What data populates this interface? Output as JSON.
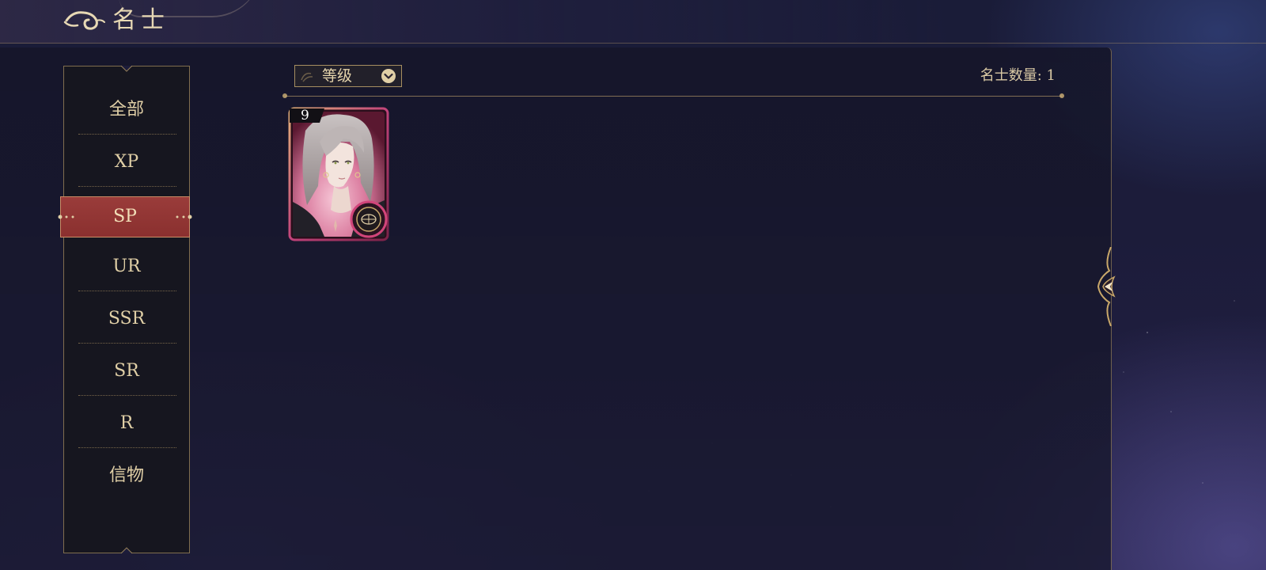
{
  "header": {
    "title": "名士",
    "back_icon": "cloud-swirl-back-icon"
  },
  "sidebar": {
    "tabs": [
      {
        "label": "全部",
        "active": false
      },
      {
        "label": "XP",
        "active": false
      },
      {
        "label": "SP",
        "active": true
      },
      {
        "label": "UR",
        "active": false
      },
      {
        "label": "SSR",
        "active": false
      },
      {
        "label": "SR",
        "active": false
      },
      {
        "label": "R",
        "active": false
      },
      {
        "label": "信物",
        "active": false
      }
    ]
  },
  "toolbar": {
    "sort_label": "等级",
    "sort_icon": "chevron-down-icon",
    "count_text": "名士数量: 1"
  },
  "cards": [
    {
      "level": "9",
      "badge_icon": "compass-emblem-icon"
    }
  ],
  "panel_handle_icon": "arrow-left-icon",
  "colors": {
    "accent_gold": "#e0cfa6",
    "active_tab_red": "#9a3c3a",
    "card_frame_pink": "#d1457a",
    "background_navy": "#1c1c3a"
  }
}
